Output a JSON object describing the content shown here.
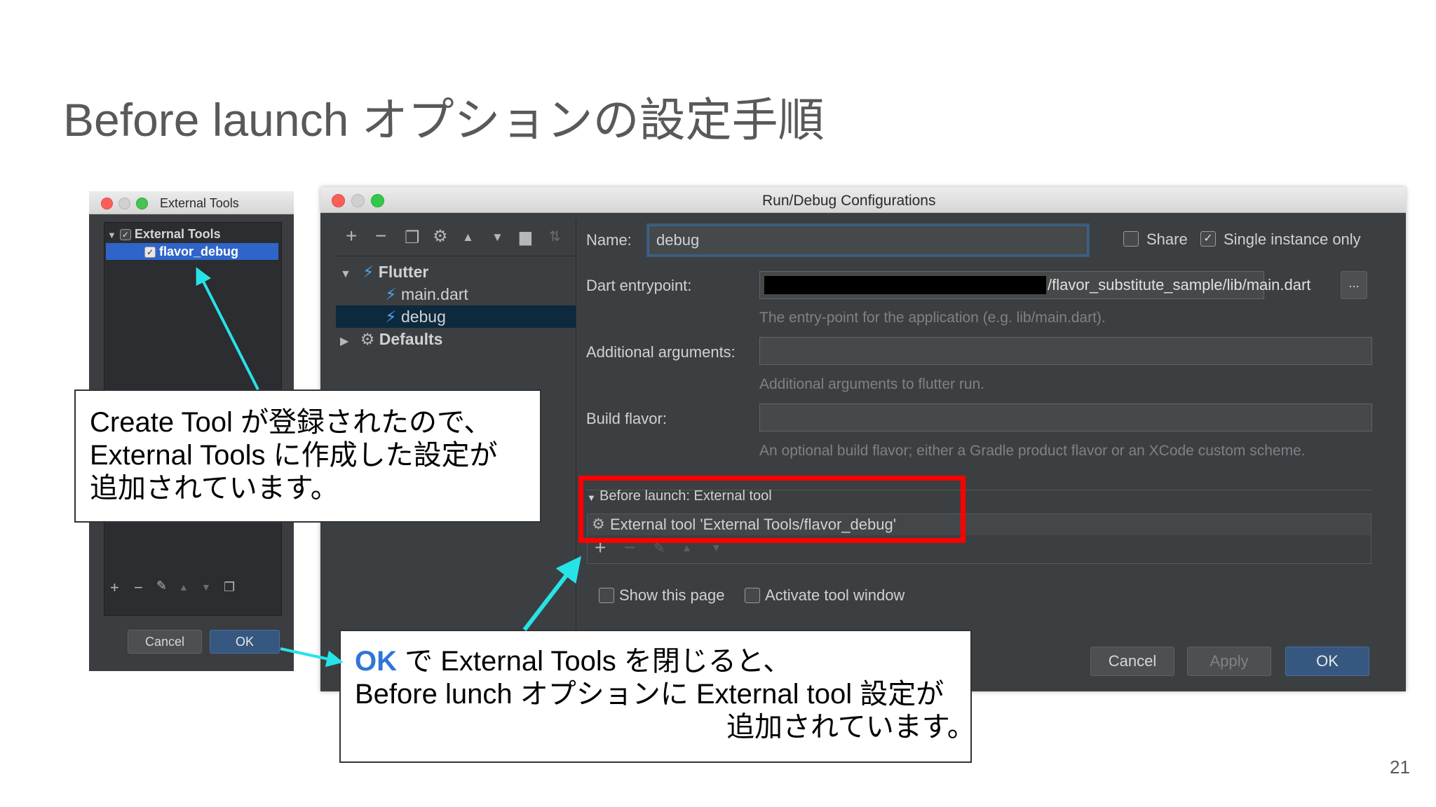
{
  "slide": {
    "title": "Before launch オプションの設定手順",
    "page_number": "21"
  },
  "external_tools_window": {
    "title": "External Tools",
    "tree": {
      "group_label": "External Tools",
      "group_checked": true,
      "item_label": "flavor_debug",
      "item_checked": true
    },
    "toolbar_icons": [
      "plus-icon",
      "minus-icon",
      "edit-icon",
      "move-up-icon",
      "move-down-icon",
      "copy-icon"
    ],
    "cancel_label": "Cancel",
    "ok_label": "OK"
  },
  "run_debug_window": {
    "title": "Run/Debug Configurations",
    "toolbar_icons": [
      "plus-icon",
      "minus-icon",
      "copy-icon",
      "wrench-icon",
      "move-up-icon",
      "move-down-icon",
      "folder-icon",
      "sort-icon"
    ],
    "tree": {
      "flutter_label": "Flutter",
      "main_dart_label": "main.dart",
      "debug_label": "debug",
      "defaults_label": "Defaults"
    },
    "name_label": "Name:",
    "name_value": "debug",
    "share_label": "Share",
    "share_checked": false,
    "single_instance_label": "Single instance only",
    "single_instance_checked": true,
    "dart_entrypoint_label": "Dart entrypoint:",
    "dart_entrypoint_value": "/flavor_substitute_sample/lib/main.dart",
    "browse_label": "...",
    "dart_entrypoint_hint": "The entry-point for the application (e.g. lib/main.dart).",
    "additional_args_label": "Additional arguments:",
    "additional_args_value": "",
    "additional_args_hint": "Additional arguments to flutter run.",
    "build_flavor_label": "Build flavor:",
    "build_flavor_value": "",
    "build_flavor_hint": "An optional build flavor; either a Gradle product flavor or an XCode custom scheme.",
    "before_launch_header": "Before launch: External tool",
    "before_launch_item": "External tool 'External Tools/flavor_debug'",
    "show_page_label": "Show this page",
    "activate_tool_label": "Activate tool window",
    "cancel_label": "Cancel",
    "apply_label": "Apply",
    "ok_label": "OK"
  },
  "callouts": {
    "left": {
      "line1": "Create Tool が登録されたので、",
      "line2": "External Tools に作成した設定が",
      "line3": "追加されています。"
    },
    "bottom": {
      "ok_word": "OK",
      "line1_rest": " で External Tools を閉じると、",
      "line2": "Before lunch オプションに External tool 設定が",
      "line3": "追加されています。"
    }
  },
  "colors": {
    "arrow": "#26e3e8",
    "highlight_box": "#ff0000",
    "ok_text": "#2f75d6",
    "ide_background": "#3c3f41"
  }
}
